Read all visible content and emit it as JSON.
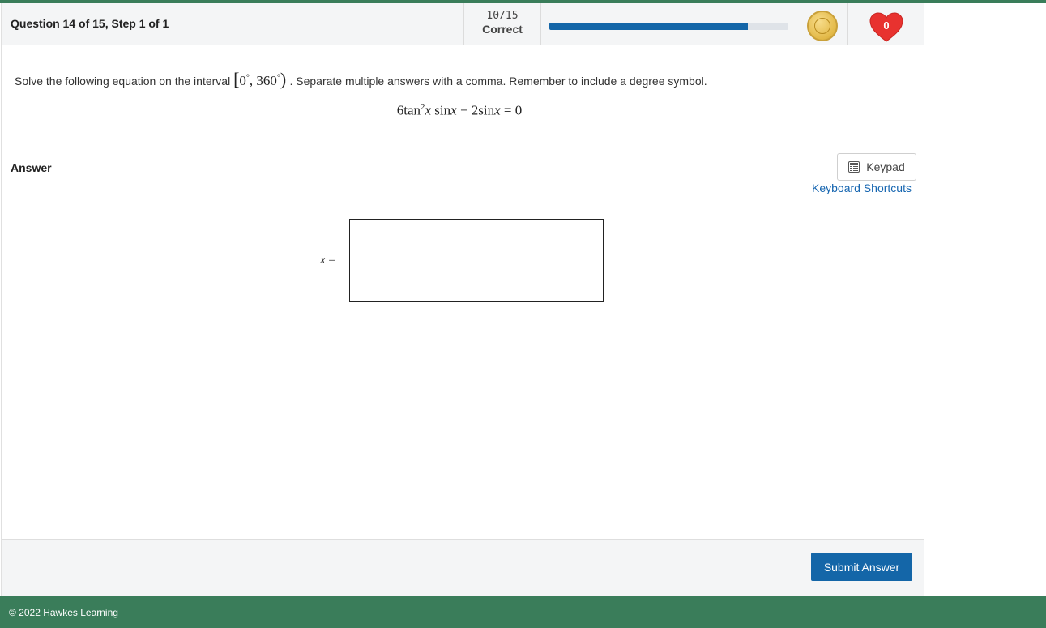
{
  "header": {
    "question_title": "Question 14 of 15, Step 1 of 1",
    "score": "10/15",
    "score_label": "Correct",
    "progress_fraction": 0.83,
    "progress_color": "#1466a8",
    "coin_icon": "gold-coin-icon",
    "hearts_count": "0",
    "heart_color": "#e8322f"
  },
  "question": {
    "text_before": "Solve the following equation on the interval",
    "interval_open": "[",
    "interval_a": "0",
    "interval_sep": ", ",
    "interval_b": "360",
    "interval_close": ")",
    "degree": "°",
    "text_after": ". Separate multiple answers with a comma. Remember to include a degree symbol.",
    "equation_coef1": "6tan",
    "equation_exp": "2",
    "equation_var1": "x",
    "equation_mid": " sin",
    "equation_var2": "x",
    "equation_minus": " − 2sin",
    "equation_var3": "x",
    "equation_rhs": " = 0"
  },
  "answer": {
    "label": "Answer",
    "keypad_label": "Keypad",
    "shortcuts_label": "Keyboard Shortcuts",
    "variable": "x",
    "equals": " =",
    "input_value": ""
  },
  "footer": {
    "submit_label": "Submit Answer"
  },
  "bottom": {
    "copyright": "© 2022 Hawkes Learning"
  },
  "colors": {
    "brand_green": "#3a7d5a",
    "accent_blue": "#1466a8"
  }
}
